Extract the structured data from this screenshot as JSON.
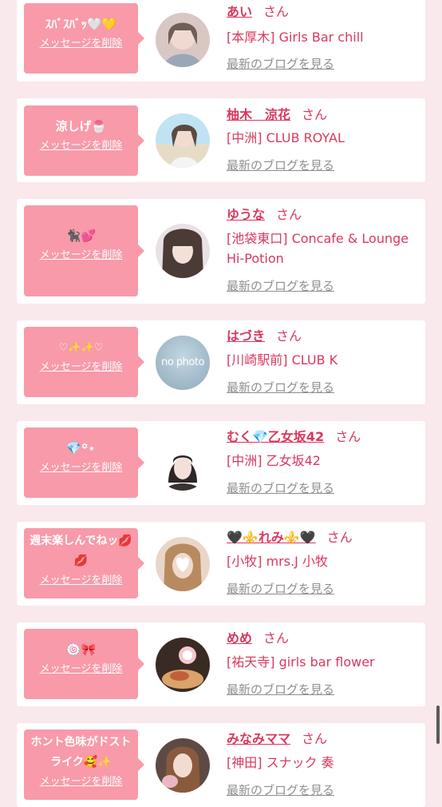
{
  "common": {
    "delete_label": "メッセージを削除",
    "blog_label": "最新のブログを見る",
    "san_label": "さん",
    "no_photo_label": "no photo"
  },
  "colors": {
    "page_bg": "#f9e8ec",
    "bubble": "#f89aa9",
    "name": "#d9385e",
    "link_gray": "#8f8f8f"
  },
  "entries": [
    {
      "message": "ｽﾊﾞｽﾊﾞｯ🤍💛",
      "name": "あい",
      "shop": "[本厚木] Girls Bar chill"
    },
    {
      "message": "涼しげ🍧",
      "name": "柚木　涼花",
      "shop": "[中洲] CLUB ROYAL"
    },
    {
      "message": "🐈‍⬛💕",
      "name": "ゆうな",
      "shop": "[池袋東口] Concafe & Lounge Hi-Potion"
    },
    {
      "message": "♡✨✨♡",
      "name": "はづき",
      "shop": "[川崎駅前] CLUB K"
    },
    {
      "message": "💎꙳⋆",
      "name": "むく💎乙女坂42",
      "shop": "[中洲] 乙女坂42"
    },
    {
      "message": "週末楽しんでねッ💋💋",
      "name": "🖤⚜️れみ⚜️🖤",
      "shop": "[小牧] mrs.J 小牧"
    },
    {
      "message": "🍥🎀",
      "name": "めめ",
      "shop": "[祐天寺] girls bar flower"
    },
    {
      "message": "ホント色味がドストライク🥰✨",
      "name": "みなみママ",
      "shop": "[神田] スナック 奏"
    }
  ]
}
